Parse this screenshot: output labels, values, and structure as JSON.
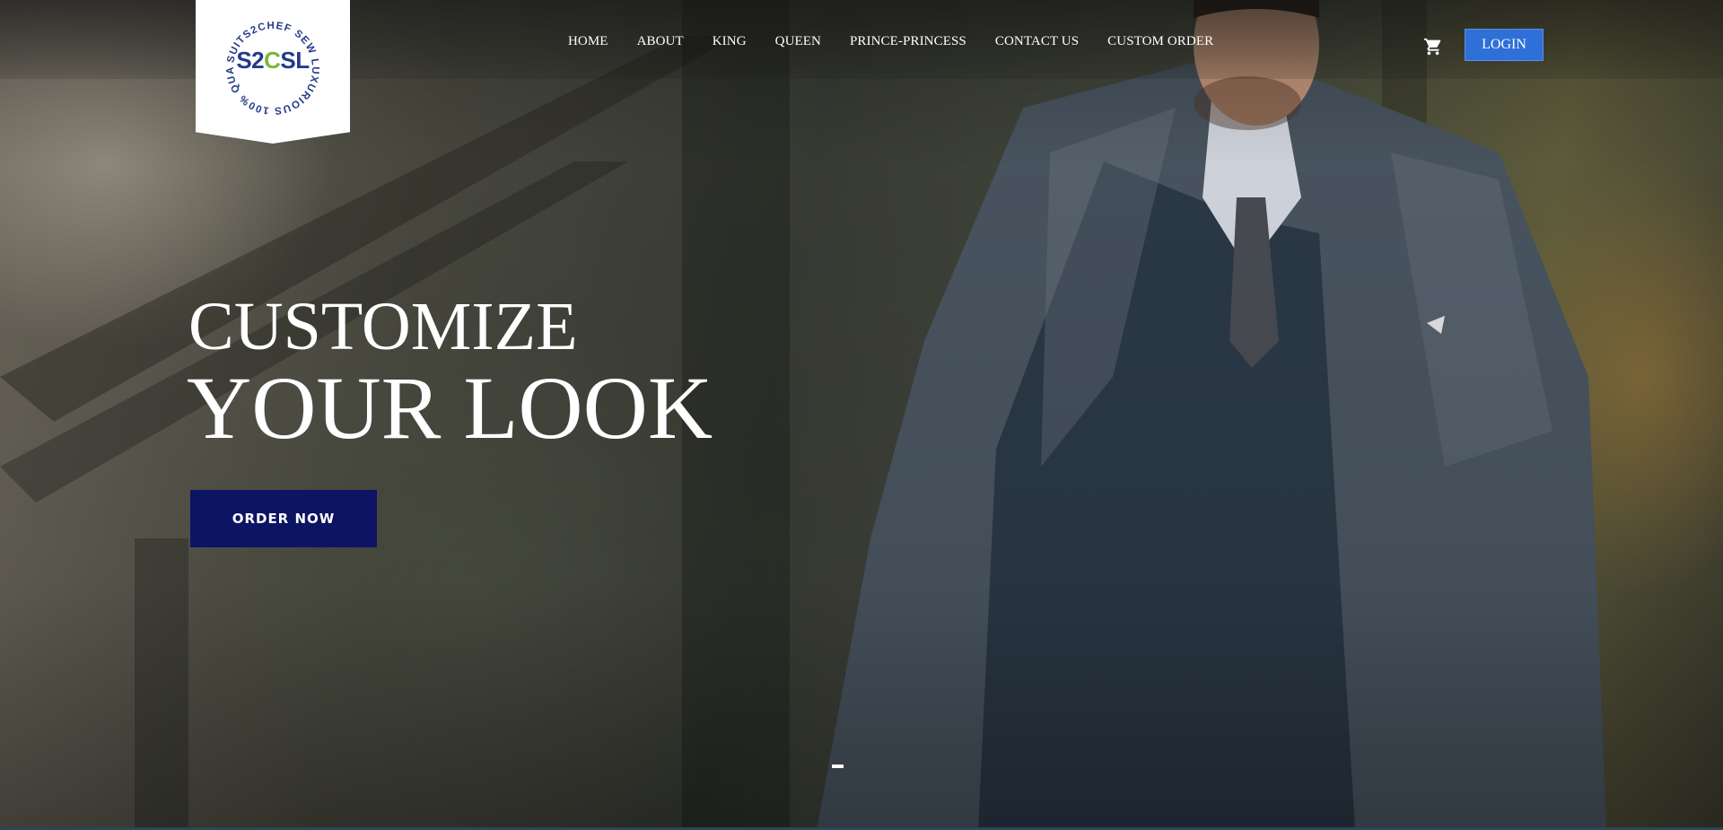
{
  "brand": {
    "logo_text": "S2CSL",
    "ring_text": "SUITS2CHEF SEW LUXURIOUS 100% QUALITY"
  },
  "nav": {
    "items": [
      {
        "label": "HOME"
      },
      {
        "label": "ABOUT"
      },
      {
        "label": "KING"
      },
      {
        "label": "QUEEN"
      },
      {
        "label": "PRINCE-PRINCESS"
      },
      {
        "label": "CONTACT US"
      },
      {
        "label": "CUSTOM ORDER"
      }
    ],
    "cart_icon": "shopping-cart-icon",
    "login_label": "LOGIN"
  },
  "hero": {
    "headline_line1": "CUSTOMIZE",
    "headline_line2": "YOUR LOOK",
    "cta_label": "ORDER NOW"
  },
  "colors": {
    "login_bg": "#2f6fd8",
    "cta_bg": "#0c1463",
    "logo_blue": "#233a8a",
    "logo_green": "#7fb53a"
  }
}
